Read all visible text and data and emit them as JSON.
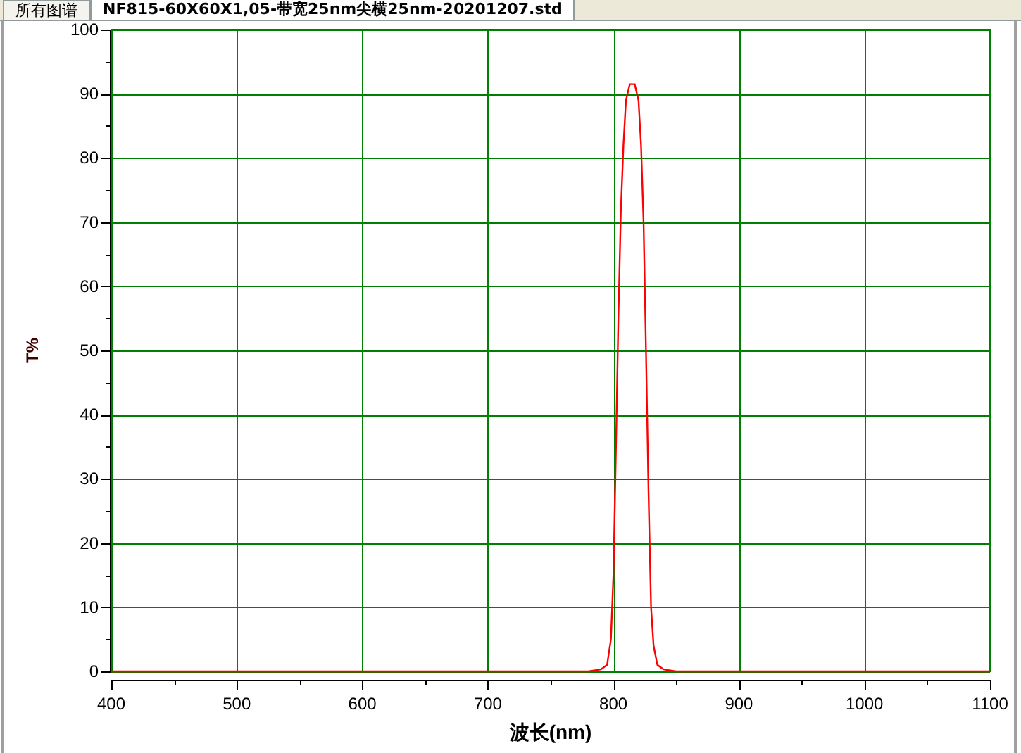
{
  "tabs": [
    {
      "label": "所有图谱",
      "selected": false
    },
    {
      "label": "NF815-60X60X1,05-带宽25nm尖横25nm-20201207.std",
      "selected": true
    }
  ],
  "chart": {
    "chart_data": {
      "type": "line",
      "grid": true,
      "xlabel": "波长(nm)",
      "ylabel": "T%",
      "xlim": [
        400,
        1100
      ],
      "ylim": [
        0,
        100
      ],
      "xticks": [
        400,
        500,
        600,
        700,
        800,
        900,
        1000,
        1100
      ],
      "yticks": [
        0,
        10,
        20,
        30,
        40,
        50,
        60,
        70,
        80,
        90,
        100
      ],
      "series": [
        {
          "color": "#ff0000",
          "x": [
            400,
            780,
            790,
            795,
            798,
            800,
            802,
            804,
            806,
            808,
            810,
            813,
            817,
            820,
            822,
            824,
            826,
            828,
            830,
            832,
            835,
            840,
            850,
            1100
          ],
          "values": [
            0,
            0,
            0.3,
            1,
            5,
            15,
            35,
            55,
            72,
            82,
            89,
            91.5,
            91.5,
            89,
            82,
            70,
            50,
            28,
            10,
            4,
            1,
            0.3,
            0,
            0
          ]
        }
      ]
    }
  }
}
